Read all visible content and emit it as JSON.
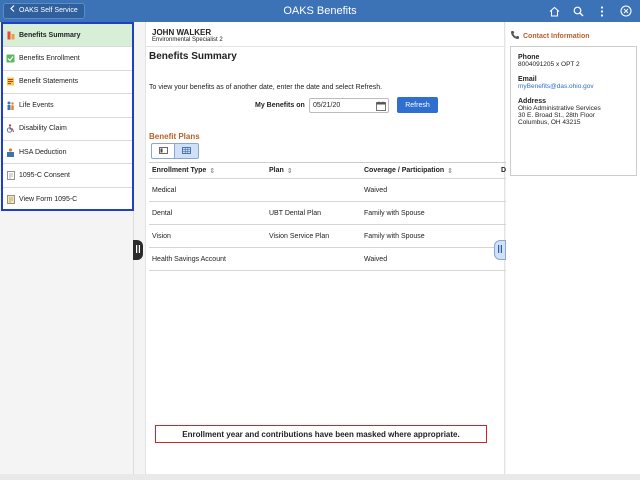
{
  "banner": {
    "back_label": "OAKS Self Service",
    "title": "OAKS Benefits",
    "icons": [
      "home-icon",
      "search-icon",
      "more-icon",
      "navbar-icon"
    ]
  },
  "nav": {
    "items": [
      {
        "label": "Benefits Summary",
        "icon": "benefits-summary-icon",
        "active": true
      },
      {
        "label": "Benefits Enrollment",
        "icon": "enrollment-icon",
        "active": false
      },
      {
        "label": "Benefit Statements",
        "icon": "statements-icon",
        "active": false
      },
      {
        "label": "Life Events",
        "icon": "life-events-icon",
        "active": false
      },
      {
        "label": "Disability Claim",
        "icon": "disability-icon",
        "active": false
      },
      {
        "label": "HSA Deduction",
        "icon": "hsa-icon",
        "active": false
      },
      {
        "label": "1095-C Consent",
        "icon": "consent-icon",
        "active": false
      },
      {
        "label": "View Form 1095-C",
        "icon": "form-icon",
        "active": false
      }
    ]
  },
  "employee": {
    "name": "JOHN WALKER",
    "title": "Environmental Specialist 2"
  },
  "page": {
    "title": "Benefits Summary",
    "instruction": "To view your benefits as of another date, enter the date and select Refresh.",
    "date_label": "My Benefits on",
    "date_value": "05/21/20",
    "refresh_label": "Refresh"
  },
  "plans": {
    "title": "Benefit Plans",
    "columns": [
      "Enrollment Type",
      "Plan",
      "Coverage / Participation",
      "D"
    ],
    "rows": [
      {
        "type": "Medical",
        "plan": "",
        "coverage": "Waived"
      },
      {
        "type": "Dental",
        "plan": "UBT Dental Plan",
        "coverage": "Family with Spouse"
      },
      {
        "type": "Vision",
        "plan": "Vision Service Plan",
        "coverage": "Family with Spouse"
      },
      {
        "type": "Health Savings Account",
        "plan": "",
        "coverage": "Waived"
      }
    ]
  },
  "note": "Enrollment year and contributions have been masked where appropriate.",
  "contact": {
    "header": "Contact Information",
    "phone_label": "Phone",
    "phone_value": "8004091205 x OPT 2",
    "email_label": "Email",
    "email_value": "myBenefits@das.ohio.gov",
    "address_label": "Address",
    "address_lines": [
      "Ohio Administrative Services",
      "30 E. Broad St., 28th Floor",
      "Columbus, OH 43215"
    ]
  },
  "colors": {
    "banner": "#3c72b6",
    "accent_orange": "#b8612a",
    "nav_highlight_border": "#1f3fc7",
    "active_item_bg": "#d6efd6",
    "refresh_button": "#2f6fd0",
    "note_border": "#c9282d"
  }
}
